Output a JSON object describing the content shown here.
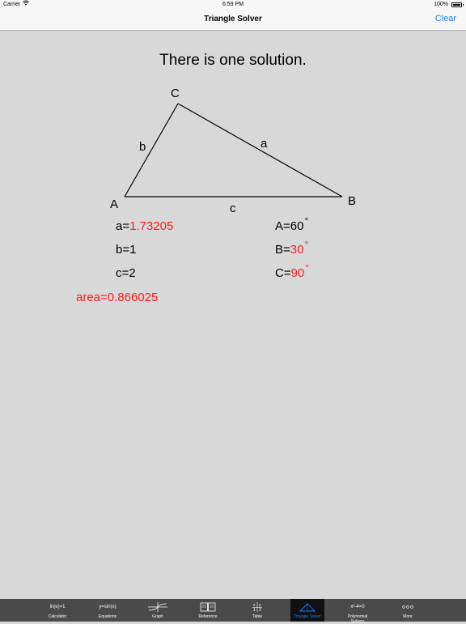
{
  "status_bar": {
    "carrier": "Carrier",
    "wifi_icon": "wifi-icon",
    "time": "6:59 PM",
    "battery": "100%"
  },
  "nav_bar": {
    "title": "Triangle Solver",
    "clear_label": "Clear"
  },
  "result": {
    "headline": "There is one solution."
  },
  "diagram": {
    "vertex_a": "A",
    "vertex_b": "B",
    "vertex_c": "C",
    "side_a": "a",
    "side_b": "b",
    "side_c": "c"
  },
  "values": {
    "a_label": "a=",
    "a_value": "1.73205",
    "b_label": "b=",
    "b_value": "1",
    "c_label": "c=",
    "c_value": "2",
    "A_label": "A=",
    "A_value": "60",
    "B_label": "B=",
    "B_value": "30",
    "C_label": "C=",
    "C_value": "90",
    "degree_symbol": "°",
    "area": "area=0.866025"
  },
  "colors": {
    "computed": "#ff1a1a",
    "accent": "#1a7ef6"
  },
  "tab_bar": {
    "tabs": [
      {
        "icon_text": "ln(e)=1",
        "label": "Calculator"
      },
      {
        "icon_text": "y=sin(x)",
        "label": "Equations"
      },
      {
        "icon_text": "graph-icon",
        "label": "Graph"
      },
      {
        "icon_text": "book-icon",
        "label": "Reference"
      },
      {
        "icon_text": "table-icon",
        "label": "Table"
      },
      {
        "icon_text": "triangle-icon",
        "label": "Triangle Solver"
      },
      {
        "icon_text": "x²-4=0",
        "label": "Polynomial Solvers"
      },
      {
        "icon_text": "ooo",
        "label": "More"
      }
    ]
  }
}
